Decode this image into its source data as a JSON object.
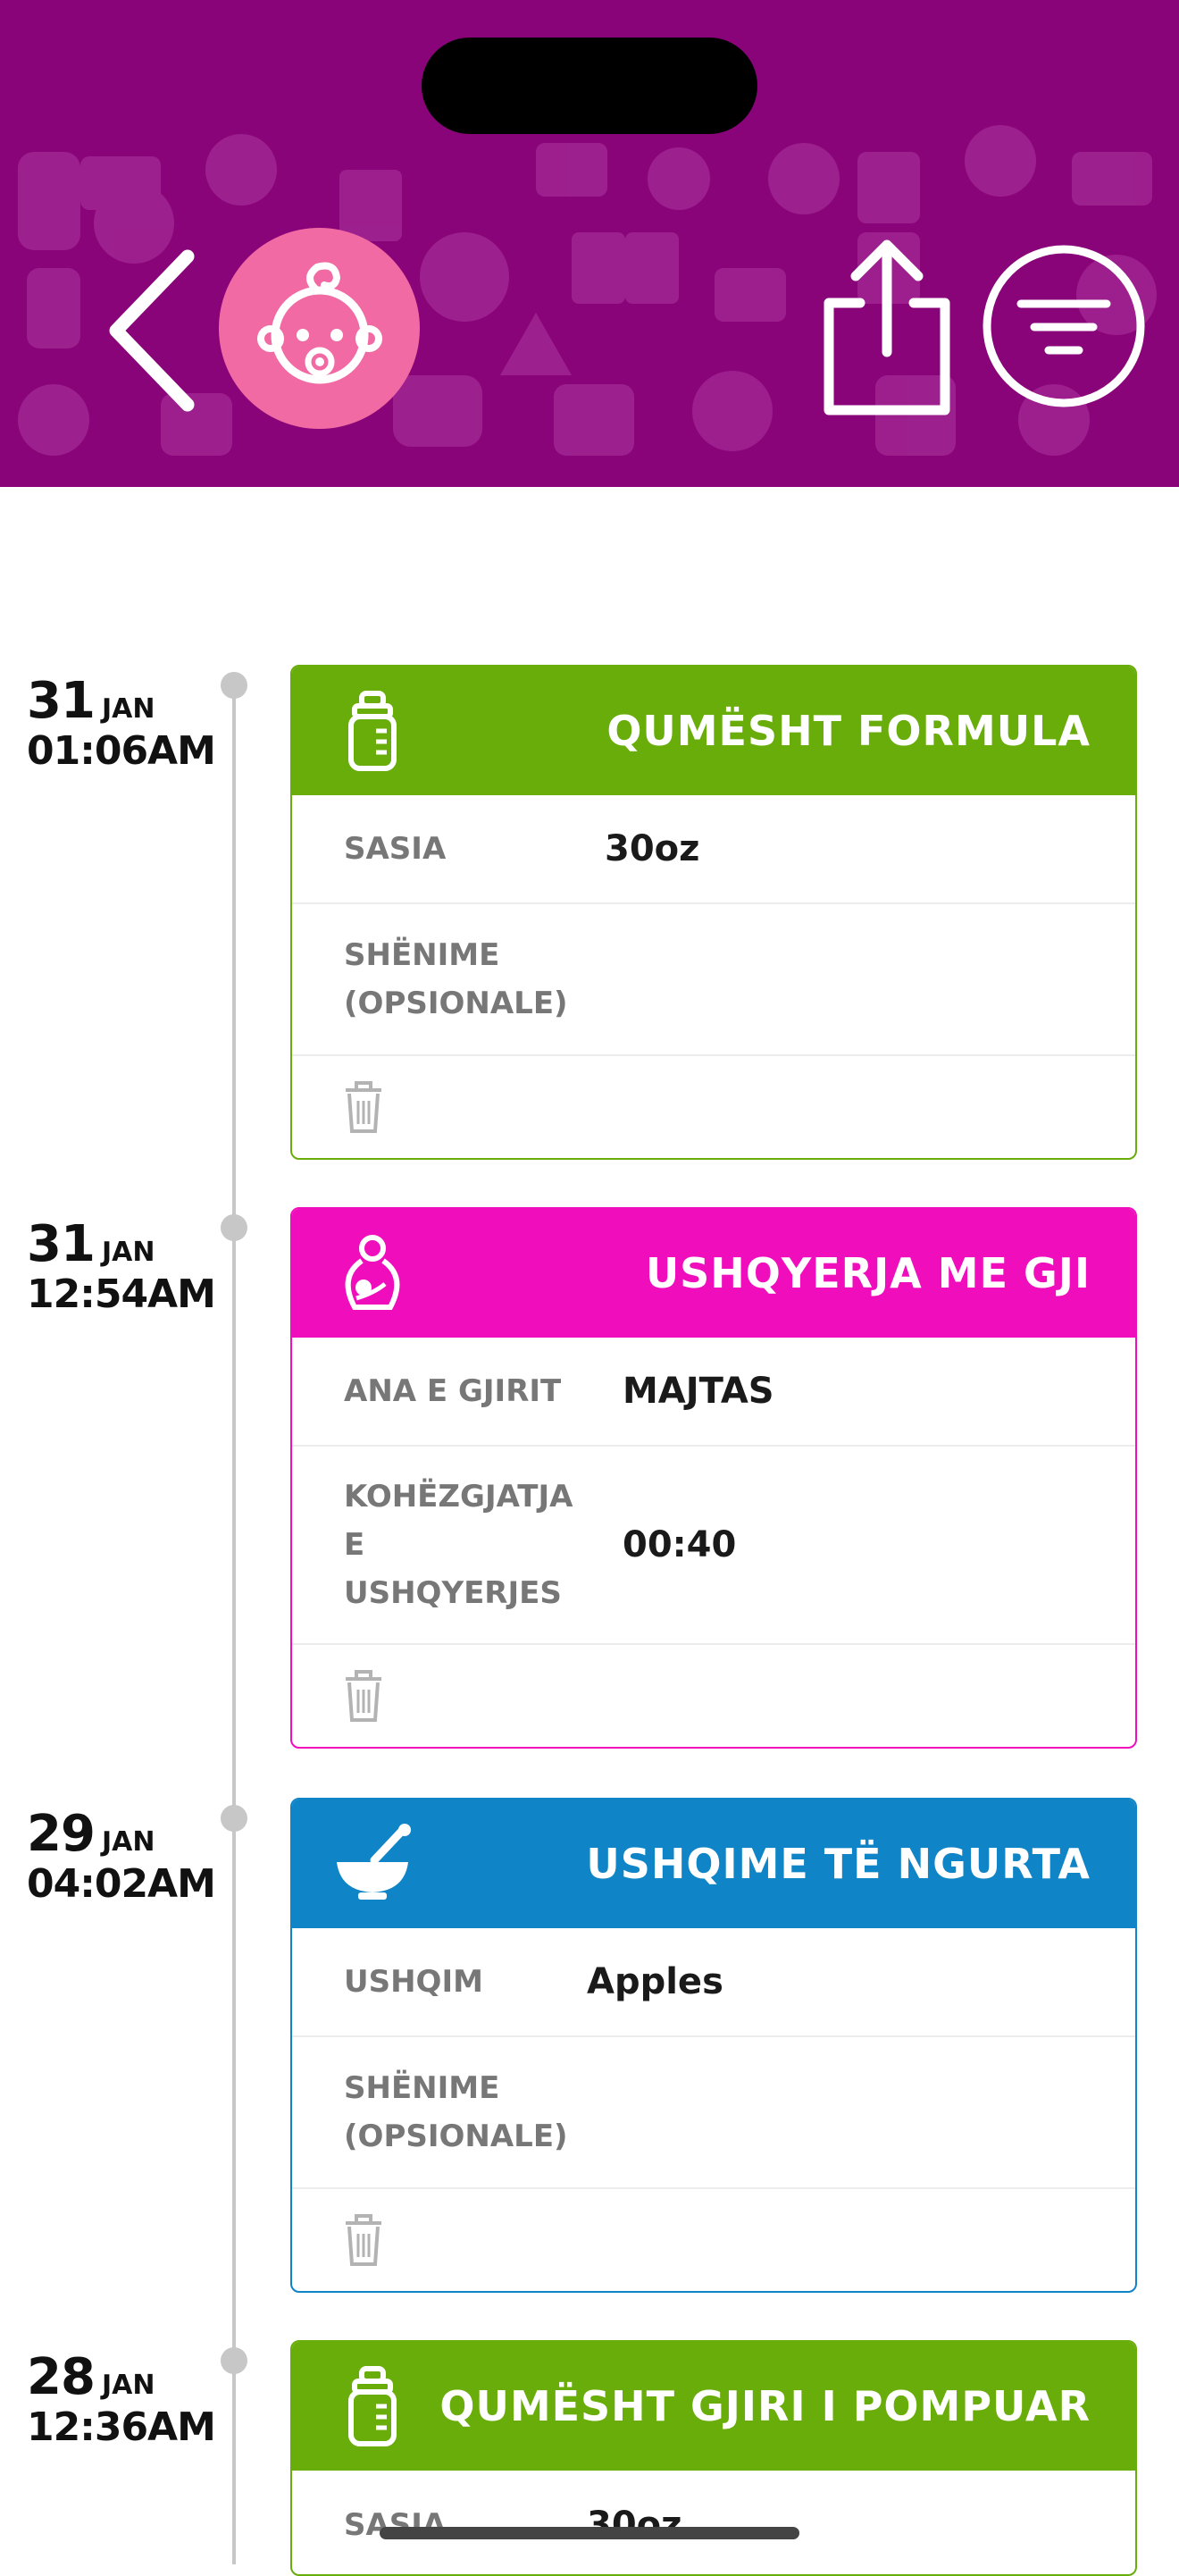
{
  "colors": {
    "header_bg": "#8a0479",
    "avatar_bg": "#f26aa3",
    "formula": "#69ad0b",
    "breastfeeding": "#ef0dbc",
    "solid_food": "#0f84c6",
    "timeline": "#c7c7c7"
  },
  "header": {
    "back_icon": "chevron-left-icon",
    "avatar_icon": "baby-face-icon",
    "share_icon": "share-icon",
    "filter_icon": "filter-icon"
  },
  "entries": [
    {
      "day": "31",
      "month": "JAN",
      "time": "01:06AM",
      "type": "formula",
      "icon": "baby-bottle-icon",
      "title": "QUMËSHT FORMULA",
      "rows": [
        {
          "label": "SASIA",
          "value": "30oz"
        },
        {
          "label": "SHËNIME (OPSIONALE)",
          "value": ""
        }
      ]
    },
    {
      "day": "31",
      "month": "JAN",
      "time": "12:54AM",
      "type": "breastfeeding",
      "icon": "breastfeeding-icon",
      "title": "USHQYERJA ME GJI",
      "rows": [
        {
          "label": "ANA E GJIRIT",
          "value": "MAJTAS"
        },
        {
          "label": "KOHËZGJATJA E USHQYERJES",
          "value": "00:40"
        }
      ]
    },
    {
      "day": "29",
      "month": "JAN",
      "time": "04:02AM",
      "type": "solid_food",
      "icon": "mortar-bowl-icon",
      "title": "USHQIME TË NGURTA",
      "rows": [
        {
          "label": "USHQIM",
          "value": "Apples"
        },
        {
          "label": "SHËNIME (OPSIONALE)",
          "value": ""
        }
      ]
    },
    {
      "day": "28",
      "month": "JAN",
      "time": "12:36AM",
      "type": "pumped",
      "icon": "baby-bottle-icon",
      "title": "QUMËSHT GJIRI I POMPUAR",
      "rows": [
        {
          "label": "SASIA",
          "value": "30oz"
        }
      ]
    }
  ]
}
